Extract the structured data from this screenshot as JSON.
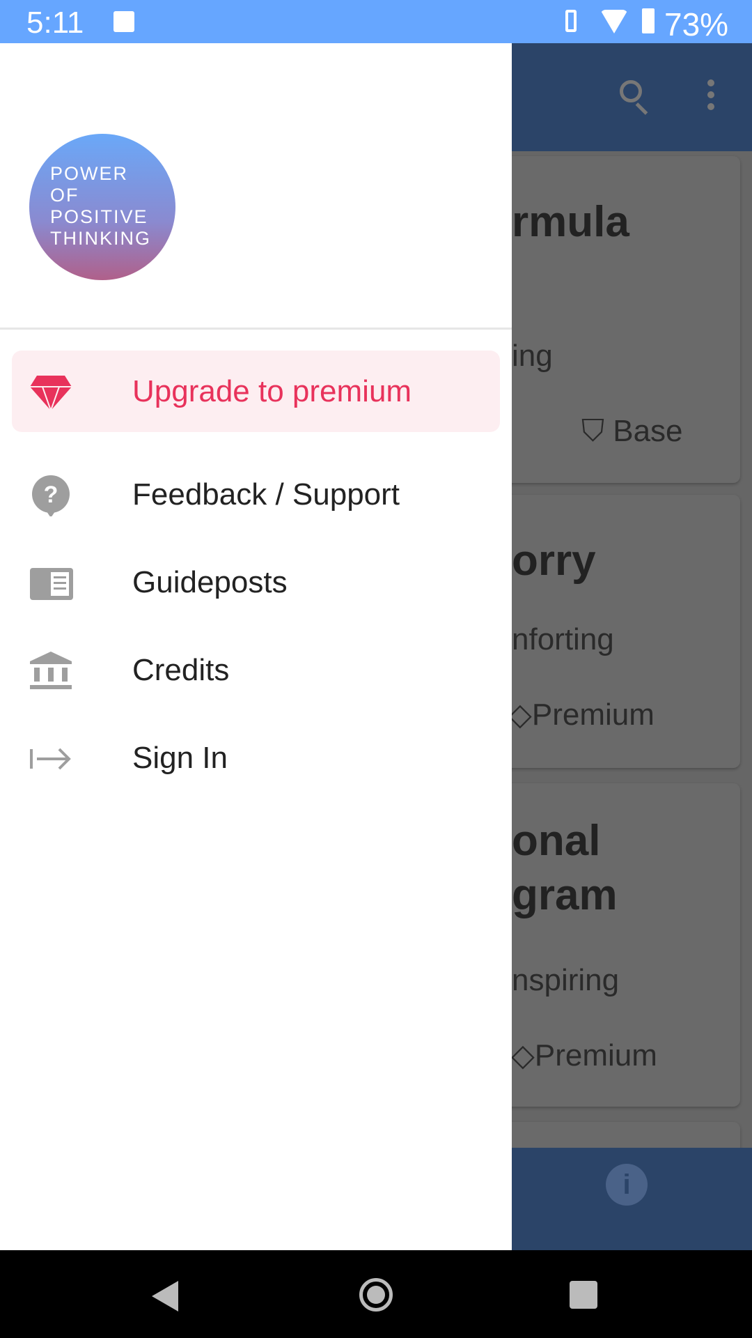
{
  "status_bar": {
    "time": "5:11",
    "battery": "73%"
  },
  "drawer": {
    "logo_text": [
      "POWER",
      "OF",
      "POSITIVE",
      "THINKING"
    ],
    "items": [
      {
        "label": "Upgrade to premium",
        "icon": "diamond-icon",
        "highlighted": true
      },
      {
        "label": "Feedback / Support",
        "icon": "help-icon"
      },
      {
        "label": "Guideposts",
        "icon": "book-icon"
      },
      {
        "label": "Credits",
        "icon": "bank-icon"
      },
      {
        "label": "Sign In",
        "icon": "sign-in-icon"
      }
    ]
  },
  "background": {
    "cards": [
      {
        "title": "rmula",
        "subtitle": "ing",
        "badge": "Base"
      },
      {
        "title": "orry",
        "subtitle": "nforting",
        "badge": "Premium"
      },
      {
        "title": "onal\ngram",
        "subtitle": "nspiring",
        "badge": "Premium"
      }
    ],
    "info_icon": "i"
  },
  "colors": {
    "accent": "#e8325b",
    "status_bar": "#66a6ff",
    "highlight_bg": "#fdeef1"
  }
}
